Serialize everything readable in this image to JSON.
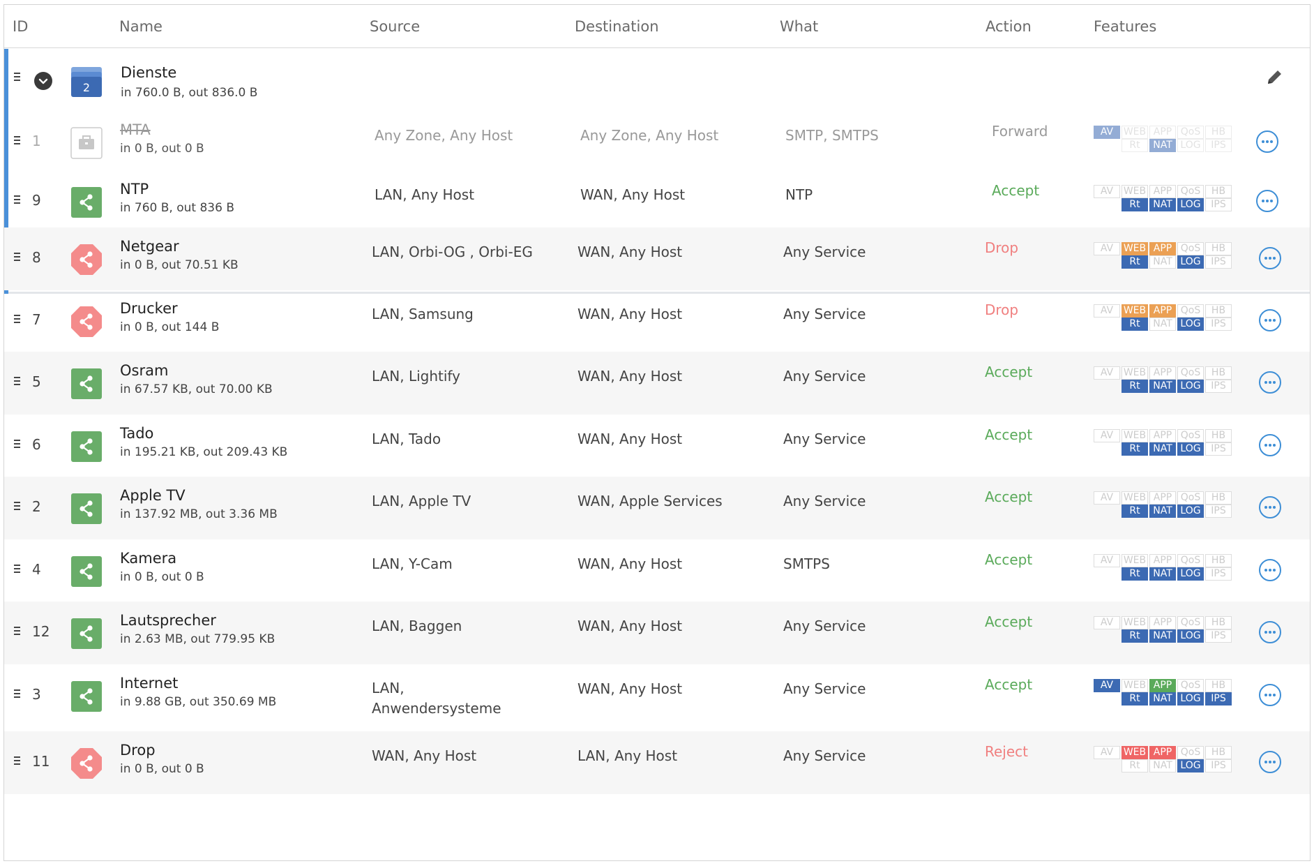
{
  "header": {
    "id": "ID",
    "name": "Name",
    "source": "Source",
    "destination": "Destination",
    "what": "What",
    "action": "Action",
    "features": "Features"
  },
  "group": {
    "name": "Dienste",
    "count": "2",
    "traffic": "in 760.0 B, out 836.0 B",
    "rules": [
      {
        "id": "1",
        "name": "MTA",
        "traffic": "in 0 B, out 0 B",
        "source": "Any Zone, Any Host",
        "destination": "Any Zone, Any Host",
        "what": "SMTP, SMTPS",
        "action": "Forward",
        "disabled": true,
        "icon": "briefcase-icon",
        "features": {
          "AV": "blue",
          "NAT": "blue"
        }
      },
      {
        "id": "9",
        "name": "NTP",
        "traffic": "in 760 B, out 836 B",
        "source": "LAN, Any Host",
        "destination": "WAN, Any Host",
        "what": "NTP",
        "action": "Accept",
        "disabled": false,
        "icon": "share-icon",
        "features": {
          "Rt": "blue",
          "NAT": "blue",
          "LOG": "blue"
        }
      }
    ]
  },
  "rules": [
    {
      "id": "8",
      "name": "Netgear",
      "traffic": "in 0 B, out 70.51 KB",
      "source": "LAN, Orbi-OG , Orbi-EG",
      "destination": "WAN, Any Host",
      "what": "Any Service",
      "action": "Drop",
      "icon": "stop-share-icon",
      "features": {
        "WEB": "orange",
        "APP": "orange",
        "Rt": "blue",
        "LOG": "blue"
      }
    },
    {
      "id": "7",
      "name": "Drucker",
      "traffic": "in 0 B, out 144 B",
      "source": "LAN, Samsung",
      "destination": "WAN, Any Host",
      "what": "Any Service",
      "action": "Drop",
      "icon": "stop-share-icon",
      "features": {
        "WEB": "orange",
        "APP": "orange",
        "Rt": "blue",
        "LOG": "blue"
      }
    },
    {
      "id": "5",
      "name": "Osram",
      "traffic": "in 67.57 KB, out 70.00 KB",
      "source": "LAN, Lightify",
      "destination": "WAN, Any Host",
      "what": "Any Service",
      "action": "Accept",
      "icon": "share-icon",
      "features": {
        "Rt": "blue",
        "NAT": "blue",
        "LOG": "blue"
      }
    },
    {
      "id": "6",
      "name": "Tado",
      "traffic": "in 195.21 KB, out 209.43 KB",
      "source": "LAN, Tado",
      "destination": "WAN, Any Host",
      "what": "Any Service",
      "action": "Accept",
      "icon": "share-icon",
      "features": {
        "Rt": "blue",
        "NAT": "blue",
        "LOG": "blue"
      }
    },
    {
      "id": "2",
      "name": "Apple TV",
      "traffic": "in 137.92 MB, out 3.36 MB",
      "source": "LAN, Apple TV",
      "destination": "WAN, Apple Services",
      "what": "Any Service",
      "action": "Accept",
      "icon": "share-icon",
      "features": {
        "Rt": "blue",
        "NAT": "blue",
        "LOG": "blue"
      }
    },
    {
      "id": "4",
      "name": "Kamera",
      "traffic": "in 0 B, out 0 B",
      "source": "LAN, Y-Cam",
      "destination": "WAN, Any Host",
      "what": "SMTPS",
      "action": "Accept",
      "icon": "share-icon",
      "features": {
        "Rt": "blue",
        "NAT": "blue",
        "LOG": "blue"
      }
    },
    {
      "id": "12",
      "name": "Lautsprecher",
      "traffic": "in 2.63 MB, out 779.95 KB",
      "source": "LAN, Baggen",
      "destination": "WAN, Any Host",
      "what": "Any Service",
      "action": "Accept",
      "icon": "share-icon",
      "features": {
        "Rt": "blue",
        "NAT": "blue",
        "LOG": "blue"
      }
    },
    {
      "id": "3",
      "name": "Internet",
      "traffic": "in 9.88 GB, out 350.69 MB",
      "source": "LAN,\nAnwendersysteme",
      "destination": "WAN, Any Host",
      "what": "Any Service",
      "action": "Accept",
      "icon": "share-icon",
      "features": {
        "AV": "blue",
        "APP": "green",
        "Rt": "blue",
        "NAT": "blue",
        "LOG": "blue",
        "IPS": "blue"
      }
    },
    {
      "id": "11",
      "name": "Drop",
      "traffic": "in 0 B, out 0 B",
      "source": "WAN, Any Host",
      "destination": "LAN, Any Host",
      "what": "Any Service",
      "action": "Reject",
      "icon": "stop-share-icon",
      "features": {
        "WEB": "red",
        "APP": "red",
        "LOG": "blue"
      }
    }
  ],
  "feature_labels": [
    "AV",
    "WEB",
    "APP",
    "QoS",
    "HB",
    "Rt",
    "NAT",
    "LOG",
    "IPS"
  ],
  "colors": {
    "accent": "#4a90d9",
    "accept": "#5aaa5a",
    "drop": "#f07f7f",
    "badge_blue": "#3c6ab3",
    "badge_orange": "#eba054",
    "badge_red": "#ef6565",
    "badge_green": "#5aaa5a"
  }
}
